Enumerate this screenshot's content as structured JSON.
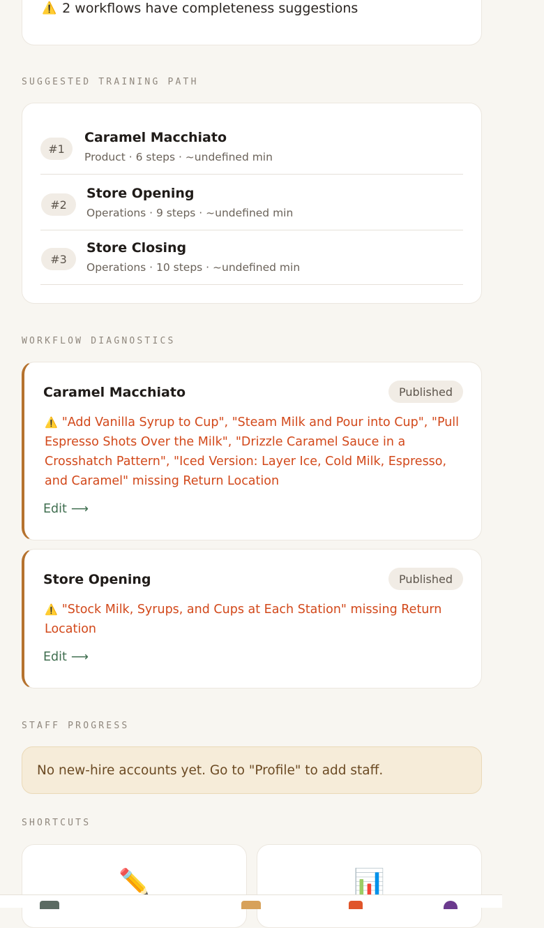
{
  "alert": {
    "icon": "warning-icon",
    "text": "2 workflows have completeness suggestions"
  },
  "training_path": {
    "heading": "SUGGESTED TRAINING PATH",
    "items": [
      {
        "rank": "#1",
        "title": "Caramel Macchiato",
        "meta": "Product · 6 steps · ~undefined min"
      },
      {
        "rank": "#2",
        "title": "Store Opening",
        "meta": "Operations · 9 steps · ~undefined min"
      },
      {
        "rank": "#3",
        "title": "Store Closing",
        "meta": "Operations · 10 steps · ~undefined min"
      }
    ]
  },
  "diagnostics": {
    "heading": "WORKFLOW DIAGNOSTICS",
    "items": [
      {
        "title": "Caramel Macchiato",
        "status": "Published",
        "message": "\"Add Vanilla Syrup to Cup\", \"Steam Milk and Pour into Cup\", \"Pull Espresso Shots Over the Milk\", \"Drizzle Caramel Sauce in a Crosshatch Pattern\", \"Iced Version: Layer Ice, Cold Milk, Espresso, and Caramel\" missing Return Location",
        "edit_label": "Edit"
      },
      {
        "title": "Store Opening",
        "status": "Published",
        "message": "\"Stock Milk, Syrups, and Cups at Each Station\" missing Return Location",
        "edit_label": "Edit"
      }
    ]
  },
  "staff_progress": {
    "heading": "STAFF PROGRESS",
    "notice": "No new-hire accounts yet. Go to \"Profile\" to add staff."
  },
  "shortcuts": {
    "heading": "SHORTCUTS",
    "items": [
      {
        "icon": "pencil-icon"
      },
      {
        "icon": "bar-chart-icon"
      }
    ]
  },
  "colors": {
    "accent_border": "#b5722e",
    "warning_text": "#d2481a",
    "link": "#3f6e4f"
  }
}
